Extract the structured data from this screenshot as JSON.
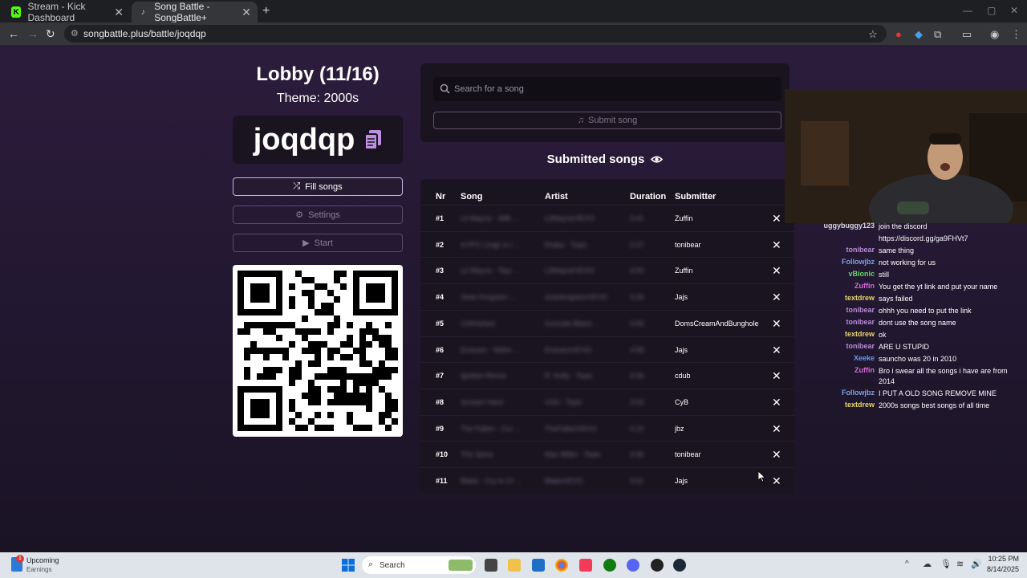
{
  "browser": {
    "tabs": [
      {
        "label": "Stream - Kick Dashboard",
        "active": false
      },
      {
        "label": "Song Battle - SongBattle+",
        "active": true
      }
    ],
    "url": "songbattle.plus/battle/joqdqp"
  },
  "lobby": {
    "title": "Lobby (11/16)",
    "theme": "Theme: 2000s",
    "code": "joqdqp",
    "fill_label": "Fill songs",
    "settings_label": "Settings",
    "start_label": "Start"
  },
  "search": {
    "placeholder": "Search for a song",
    "submit_label": "Submit song"
  },
  "submitted": {
    "title": "Submitted songs",
    "columns": [
      "Nr",
      "Song",
      "Artist",
      "Duration",
      "Submitter"
    ],
    "rows": [
      {
        "nr": "#1",
        "song": "Lil Wayne - Milli ...",
        "artist": "LilWayneVEVO",
        "duration": "3:41",
        "submitter": "Zuffin"
      },
      {
        "nr": "#2",
        "song": "A PFC Lingh is t ...",
        "artist": "Drake - Topic",
        "duration": "3:37",
        "submitter": "tonibear"
      },
      {
        "nr": "#3",
        "song": "Lil Wayne - Tayl ...",
        "artist": "LilWayneVEVO",
        "duration": "4:00",
        "submitter": "Zuffin"
      },
      {
        "nr": "#4",
        "song": "Sean Kingston ...",
        "artist": "seankingstonVEVO",
        "duration": "3:26",
        "submitter": "Jajs"
      },
      {
        "nr": "#5",
        "song": "Unfinished",
        "artist": "Gonzalo Blaze ...",
        "duration": "3:59",
        "submitter": "DomsCreamAndBunghole"
      },
      {
        "nr": "#6",
        "song": "Eminem - Witho ...",
        "artist": "EminemVEVO",
        "duration": "4:58",
        "submitter": "Jajs"
      },
      {
        "nr": "#7",
        "song": "Ignition Remix",
        "artist": "R. Kelly - Topic",
        "duration": "3:06",
        "submitter": "cdub"
      },
      {
        "nr": "#8",
        "song": "Scream Hard",
        "artist": "USA - Topic",
        "duration": "3:02",
        "submitter": "CyB"
      },
      {
        "nr": "#9",
        "song": "The Fallen - Cur ...",
        "artist": "TheFallenVEVO",
        "duration": "4:10",
        "submitter": "jbz"
      },
      {
        "nr": "#10",
        "song": "The Spice",
        "artist": "Mac Miller - Topic",
        "duration": "3:36",
        "submitter": "tonibear"
      },
      {
        "nr": "#11",
        "song": "Blake - Cry In Cr ...",
        "artist": "BlakeVEVO",
        "duration": "3:51",
        "submitter": "Jajs"
      }
    ]
  },
  "chat": [
    {
      "user": "uggybuggy123",
      "msg": "join the discord",
      "color": "#d8d8d8"
    },
    {
      "user": "",
      "msg": "https://discord.gg/ga9FHVt7",
      "color": "#d8d8d8"
    },
    {
      "user": "tonibear",
      "msg": "same thing",
      "color": "#b88ad8"
    },
    {
      "user": "Followjbz",
      "msg": "not working for us",
      "color": "#7aa0e8"
    },
    {
      "user": "vBionic",
      "msg": "still",
      "color": "#62d862"
    },
    {
      "user": "Zuffin",
      "msg": "You get the yt link and put your name",
      "color": "#d86ad8"
    },
    {
      "user": "textdrew",
      "msg": "says failed",
      "color": "#e8d46a"
    },
    {
      "user": "tonibear",
      "msg": "ohhh you need to put the link",
      "color": "#b88ad8"
    },
    {
      "user": "tonibear",
      "msg": "dont use the song name",
      "color": "#b88ad8"
    },
    {
      "user": "textdrew",
      "msg": "ok",
      "color": "#e8d46a"
    },
    {
      "user": "tonibear",
      "msg": "ARE U STUPID",
      "color": "#b88ad8"
    },
    {
      "user": "Xeeke",
      "msg": "sauncho was 20 in 2010",
      "color": "#6a9be8"
    },
    {
      "user": "Zuffin",
      "msg": "Bro i swear all the songs i have are from 2014",
      "color": "#d86ad8"
    },
    {
      "user": "Followjbz",
      "msg": "I PUT A OLD SONG REMOVE MINE",
      "color": "#7aa0e8"
    },
    {
      "user": "textdrew",
      "msg": "2000s songs best songs of all time",
      "color": "#e8d46a"
    }
  ],
  "taskbar": {
    "widget_title": "Upcoming",
    "widget_sub": "Earnings",
    "widget_badge": "1",
    "search_label": "Search",
    "time": "10:25 PM",
    "date": "8/14/2025"
  },
  "colors": {
    "accent": "#c9b4e6",
    "page_bg": "#2a1b38",
    "card_bg": "#1a1420"
  }
}
